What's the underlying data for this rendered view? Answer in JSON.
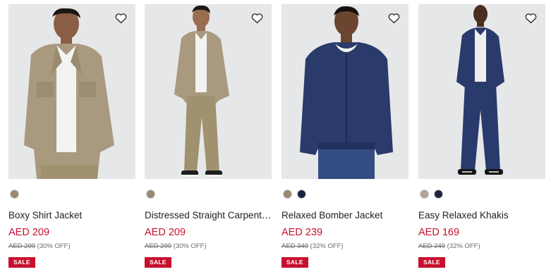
{
  "products": [
    {
      "name": "Boxy Shirt Jacket",
      "price": "AED 209",
      "was_price": "AED 299",
      "discount": "(30% OFF)",
      "badge": "SALE",
      "swatches": [
        "#9b8870"
      ],
      "image_alt": "Man wearing khaki boxy shirt jacket over white tee"
    },
    {
      "name": "Distressed Straight Carpenter ...",
      "price": "AED 209",
      "was_price": "AED 299",
      "discount": "(30% OFF)",
      "badge": "SALE",
      "swatches": [
        "#9b8870"
      ],
      "image_alt": "Man wearing khaki jacket and distressed straight carpenter pants"
    },
    {
      "name": "Relaxed Bomber Jacket",
      "price": "AED 239",
      "was_price": "AED 349",
      "discount": "(32% OFF)",
      "badge": "SALE",
      "swatches": [
        "#9b8870",
        "#1d2340"
      ],
      "image_alt": "Man wearing navy relaxed bomber jacket with jeans"
    },
    {
      "name": "Easy Relaxed Khakis",
      "price": "AED 169",
      "was_price": "AED 249",
      "discount": "(32% OFF)",
      "badge": "SALE",
      "swatches": [
        "#b5a395",
        "#1d2340"
      ],
      "image_alt": "Man wearing navy jacket and navy easy relaxed khakis"
    }
  ],
  "colors": {
    "sale_red": "#c8102e",
    "image_bg": "#e6e7e9"
  },
  "icons": {
    "wishlist": "heart-outline-icon"
  }
}
